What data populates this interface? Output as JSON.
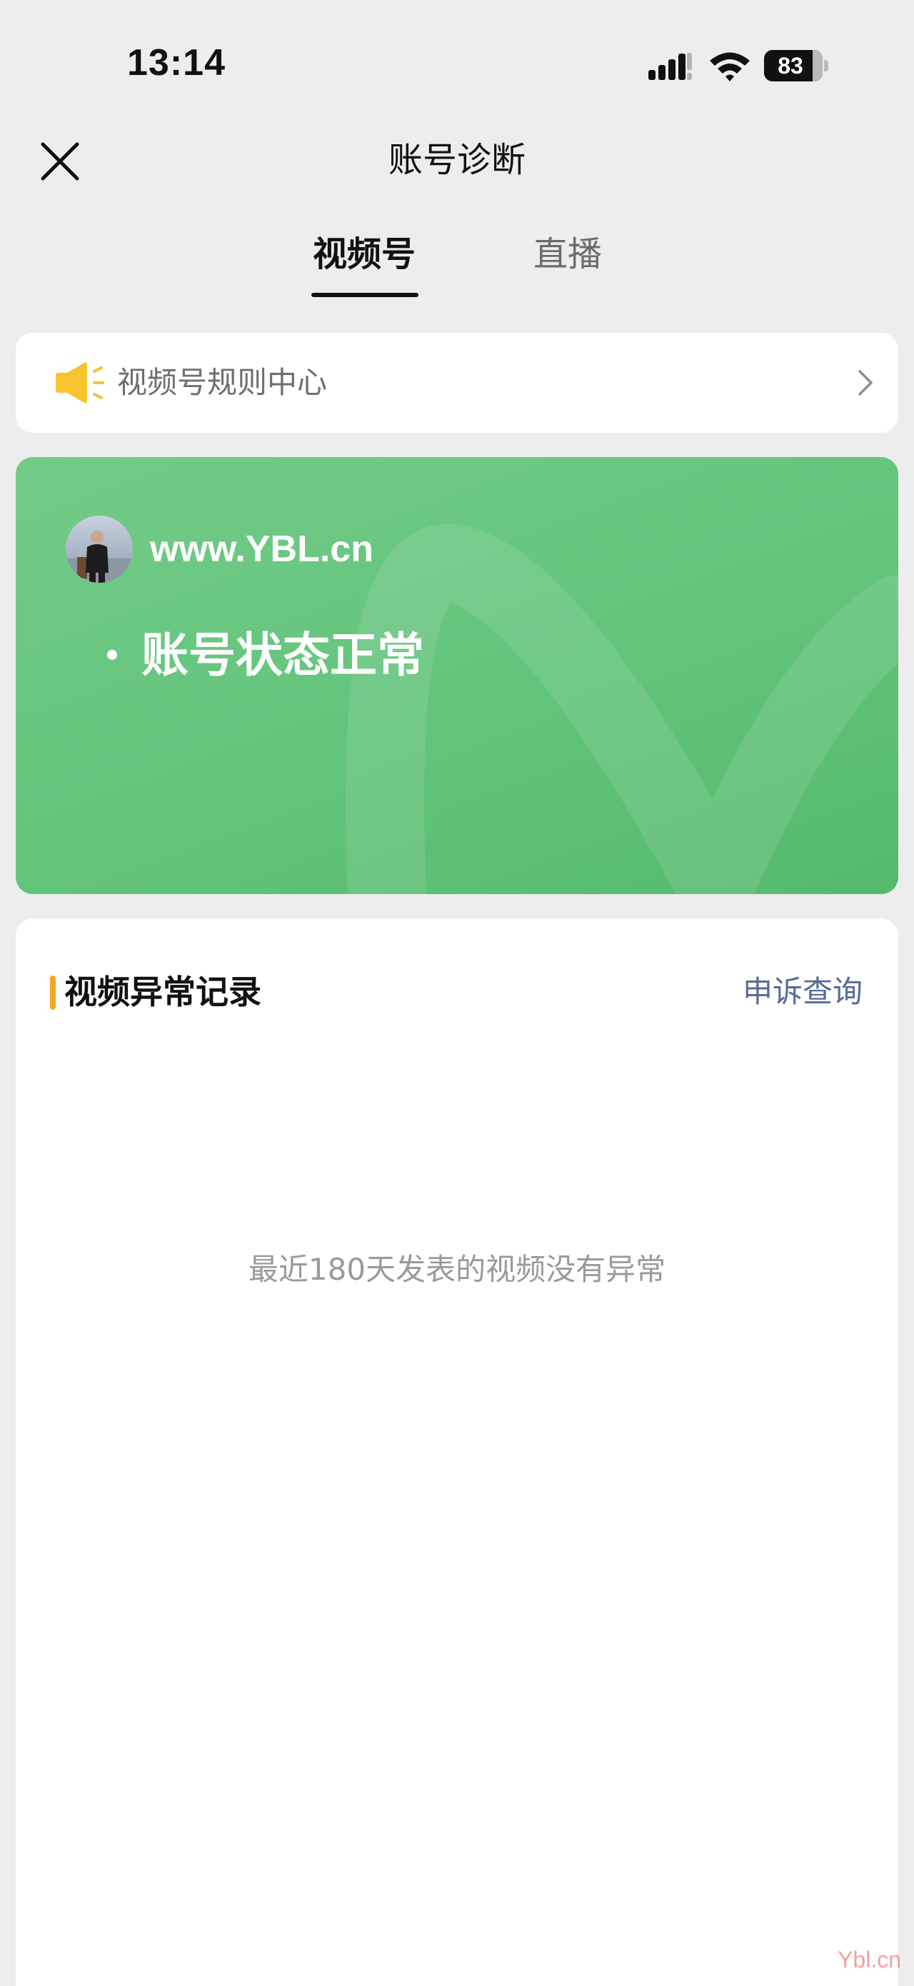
{
  "status_bar": {
    "time": "13:14",
    "battery_level": "83",
    "battery_fraction": 0.83
  },
  "header": {
    "title": "账号诊断",
    "close_icon": "close-icon"
  },
  "tabs": [
    {
      "label": "视频号",
      "active": true
    },
    {
      "label": "直播",
      "active": false
    }
  ],
  "rules_center": {
    "label": "视频号规则中心",
    "icon": "speaker-icon",
    "accent_color": "#f7c32e"
  },
  "account": {
    "name": "www.YBL.cn",
    "status": "账号状态正常",
    "card_color": "#63c47b"
  },
  "records": {
    "title": "视频异常记录",
    "appeal_link": "申诉查询",
    "empty_message": "最近180天发表的视频没有异常",
    "accent_color": "#f5a623",
    "link_color": "#576b95"
  },
  "watermark": "Ybl.cn"
}
